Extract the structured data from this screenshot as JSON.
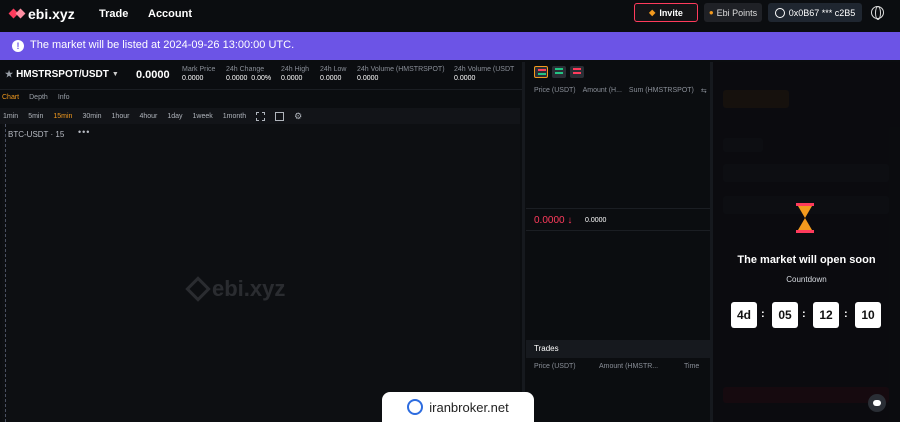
{
  "header": {
    "logo_text": "ebi.xyz",
    "nav": [
      "Trade",
      "Account"
    ],
    "invite_label": "Invite",
    "points_label": "Ebi Points",
    "wallet_label": "0x0B67 *** c2B5"
  },
  "banner": {
    "icon": "!",
    "text": "The market will be listed at 2024-09-26 13:00:00 UTC."
  },
  "ticker": {
    "pair": "HMSTRSPOT/USDT",
    "price": "0.0000",
    "stats": [
      {
        "label": "Mark Price",
        "value": "0.0000"
      },
      {
        "label": "24h Change",
        "value": "0.0000  0.00%"
      },
      {
        "label": "24h High",
        "value": "0.0000"
      },
      {
        "label": "24h Low",
        "value": "0.0000"
      },
      {
        "label": "24h Volume (HMSTRSPOT)",
        "value": "0.0000"
      },
      {
        "label": "24h Volume (USDT",
        "value": "0.0000"
      }
    ]
  },
  "tabs": [
    "Chart",
    "Depth",
    "Info"
  ],
  "intervals": [
    "1min",
    "5min",
    "15min",
    "30min",
    "1hour",
    "4hour",
    "1day",
    "1week",
    "1month"
  ],
  "chart": {
    "symbol_label": "BTC-USDT · 15",
    "more": "•••",
    "watermark": "ebi.xyz"
  },
  "orderbook": {
    "headers": [
      "Price (USDT)",
      "Amount (H...",
      "Sum (HMSTRSPOT)"
    ],
    "mid_price": "0.0000 ↓",
    "mark_price": "0.0000",
    "trades_title": "Trades",
    "trades_headers": [
      "Price (USDT)",
      "Amount (HMSTR...",
      "Time"
    ]
  },
  "countdown": {
    "title": "The market will open soon",
    "label": "Countdown",
    "days": "4d",
    "hours": "05",
    "minutes": "12",
    "seconds": "10"
  },
  "overlay_badge": {
    "text": "iranbroker.net"
  },
  "colors": {
    "accent": "#f39a1e",
    "brand": "#ff3b5c",
    "banner": "#6c54e6",
    "sell": "#ff3b5c"
  }
}
